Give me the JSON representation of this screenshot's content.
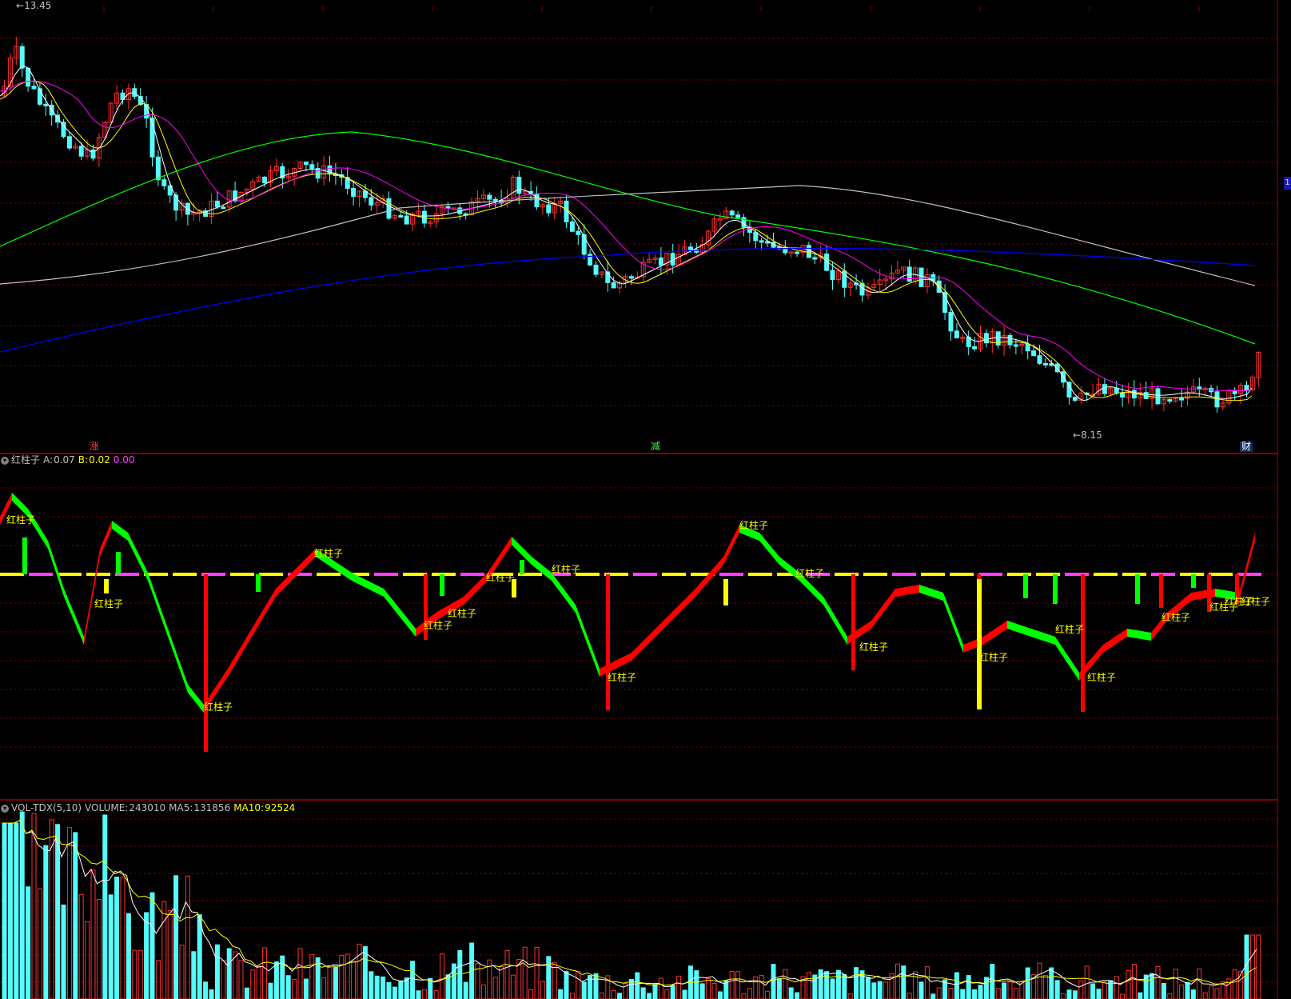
{
  "price_panel": {
    "high_marker": "13.45",
    "low_marker": "8.15",
    "event_markers": [
      {
        "label": "涨",
        "color": "#ff4040"
      },
      {
        "label": "减",
        "color": "#40ff40"
      },
      {
        "label": "财",
        "color": "#ffffff"
      }
    ],
    "side_badge": "1"
  },
  "indicator_panel": {
    "name": "红柱子",
    "a_label": "A:",
    "a_value": "0.07",
    "b_label": "B:",
    "b_value": "0.02",
    "c_value": "0.00",
    "signal_label": "红柱子",
    "colors": {
      "up": "#ff0000",
      "down": "#00ff00",
      "yellow": "#ffff00",
      "magenta": "#ff40ff"
    }
  },
  "volume_panel": {
    "name": "VOL-TDX(5,10)",
    "volume_label": "VOLUME:",
    "volume_value": "243010",
    "ma5_label": "MA5:",
    "ma5_value": "131856",
    "ma10_label": "MA10:",
    "ma10_value": "92524"
  },
  "colors": {
    "up_candle": "#ff3030",
    "down_candle": "#54fcfc",
    "ma5": "#ffffff",
    "ma10": "#ffff00",
    "ma20": "#ff00ff",
    "ma60": "#00ff00",
    "ma120": "#c0c0c0",
    "ma250": "#0000ff",
    "grid": "#8b0000"
  }
}
